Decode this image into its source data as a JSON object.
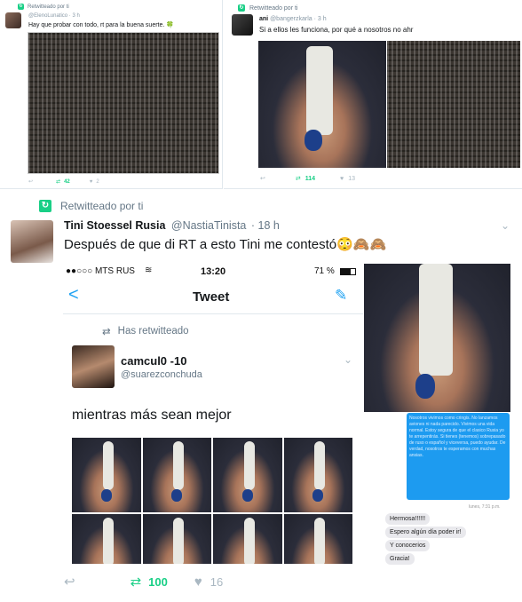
{
  "tweet1": {
    "rt_label": "Retwitteado por ti",
    "handle_time": "@ElenoLunatico · 3 h",
    "text": "Hay que probar con todo, rt para la buena suerte.",
    "clover": "🍀",
    "retweets": "42",
    "likes": "2"
  },
  "tweet2": {
    "rt_label": "Retwitteado por ti",
    "name": "ani",
    "handle_time": "@bangerzkarla · 3 h",
    "text": "Si a ellos les funciona, por qué a nosotros no ahr",
    "retweets": "114",
    "likes": "13"
  },
  "main": {
    "rt_label": "Retwitteado por ti",
    "name": "Tini Stoessel Rusia",
    "handle": "@NastiaTinista",
    "time": "· 18 h",
    "text": "Después de que di RT a esto Tini me contestó😳🙈🙈",
    "retweets": "100",
    "likes": "16"
  },
  "phone": {
    "carrier": "●●○○○ MTS RUS",
    "clock": "13:20",
    "battery": "71 %",
    "title": "Tweet",
    "back": "<",
    "has_retweeted": "Has retwitteado",
    "user_name": "camcul0 -10",
    "user_handle": "@suarezconchuda",
    "tweet_text": "mientras más sean mejor"
  },
  "chat": {
    "blue_text": "Nosotros vivimos como cringis. No lanzamos aviones ni nada parecido. Vivimos una vida normal. Estoy segura de que el clasico Rusia yo te arrepentirás. Si tienes (tenemos) sobrepasado de ruso o español y viceversa, puedo ayudar. De verdad, nosotros te esperamos con muchas ansias.",
    "time": "lunes, 7:31 p.m.",
    "messages": [
      "Hermosa!!!!!!",
      "Espero algún día poder ir!",
      "Y conocerios",
      "Gracia!"
    ]
  },
  "colors": {
    "retweet_green": "#19cf86",
    "link_blue": "#1da1f2",
    "muted": "#657786"
  }
}
